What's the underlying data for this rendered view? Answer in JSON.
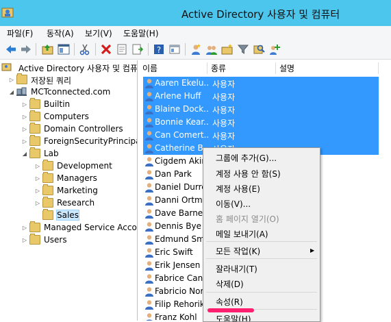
{
  "window": {
    "title": "Active Directory 사용자 및 컴퓨터"
  },
  "menu": [
    "파일(F)",
    "동작(A)",
    "보기(V)",
    "도움말(H)"
  ],
  "toolbar": {
    "buttons": [
      "back-arrow-icon",
      "forward-arrow-icon",
      "up-folder-icon",
      "show-console-tree-icon",
      "cut-icon",
      "delete-icon",
      "properties-sheet-icon",
      "export-list-icon",
      "help-icon",
      "console-view-icon",
      "new-user-icon",
      "new-group-icon",
      "new-ou-icon",
      "filter-icon",
      "find-icon",
      "add-to-group-icon"
    ]
  },
  "tree": {
    "root": "Active Directory 사용자 및 컴퓨터",
    "saved_queries": "저장된 쿼리",
    "domain": "MCTconnected.com",
    "domain_children": [
      "Builtin",
      "Computers",
      "Domain Controllers",
      "ForeignSecurityPrincipals",
      "Lab",
      "Managed Service Accou",
      "Users"
    ],
    "lab_children": [
      "Development",
      "Managers",
      "Marketing",
      "Research",
      "Sales"
    ]
  },
  "list": {
    "columns": [
      "이름",
      "종류",
      "설명"
    ],
    "rows": [
      {
        "name": "Aaren Ekelu...",
        "type": "사용자",
        "selected": true
      },
      {
        "name": "Arlene Huff",
        "type": "사용자",
        "selected": true
      },
      {
        "name": "Blaine Dock...",
        "type": "사용자",
        "selected": true
      },
      {
        "name": "Bonnie Kear...",
        "type": "사용자",
        "selected": true
      },
      {
        "name": "Can Comert...",
        "type": "사용자",
        "selected": true
      },
      {
        "name": "Catherine B...",
        "type": "사용자",
        "selected": true
      },
      {
        "name": "Cigdem Akin",
        "type": "",
        "selected": false
      },
      {
        "name": "Dan Park",
        "type": "",
        "selected": false
      },
      {
        "name": "Daniel Durrer",
        "type": "",
        "selected": false
      },
      {
        "name": "Danni Ortman",
        "type": "",
        "selected": false
      },
      {
        "name": "Dave Barnett",
        "type": "",
        "selected": false
      },
      {
        "name": "Dennis Bye",
        "type": "",
        "selected": false
      },
      {
        "name": "Edmund Smith",
        "type": "",
        "selected": false
      },
      {
        "name": "Eric Swift",
        "type": "",
        "selected": false
      },
      {
        "name": "Erik Jensen",
        "type": "",
        "selected": false
      },
      {
        "name": "Fabrice Canel",
        "type": "",
        "selected": false
      },
      {
        "name": "Fabricio Noriega",
        "type": "",
        "selected": false
      },
      {
        "name": "Filip Rehorik",
        "type": "",
        "selected": false
      },
      {
        "name": "Franz Kohl",
        "type": "",
        "selected": false
      }
    ]
  },
  "context_menu": {
    "items": [
      {
        "label": "그룹에 추가(G)...",
        "disabled": false
      },
      {
        "label": "계정 사용 안 함(S)",
        "disabled": false
      },
      {
        "label": "계정 사용(E)",
        "disabled": false
      },
      {
        "label": "이동(V)...",
        "disabled": false
      },
      {
        "label": "홈 페이지 열기(O)",
        "disabled": true
      },
      {
        "label": "메일 보내기(A)",
        "disabled": false
      },
      {
        "label": "모든 작업(K)",
        "disabled": false,
        "submenu": true
      },
      {
        "label": "잘라내기(T)",
        "disabled": false
      },
      {
        "label": "삭제(D)",
        "disabled": false
      },
      {
        "label": "속성(R)",
        "disabled": false
      },
      {
        "label": "도움말(H)",
        "disabled": false
      }
    ]
  },
  "colors": {
    "titlebar": "#4dc6ed",
    "selection": "#3399ff",
    "highlight_mark": "#ff1f6e"
  }
}
